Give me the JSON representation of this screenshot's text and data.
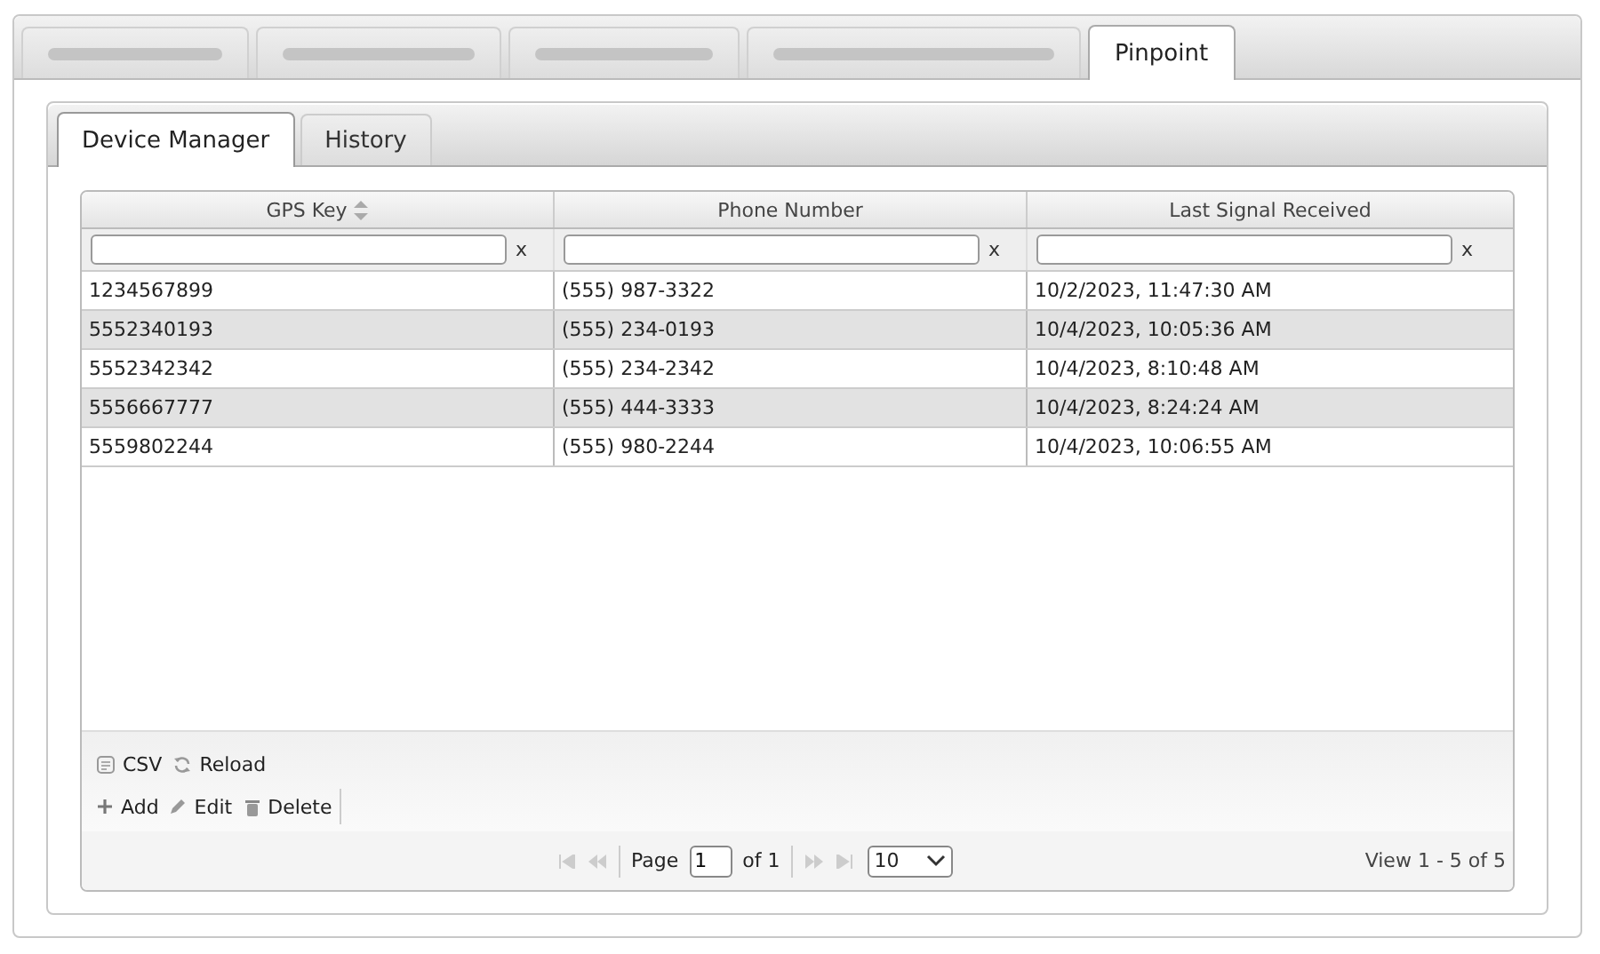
{
  "top_tabs": [
    {
      "kind": "redacted",
      "selected": false
    },
    {
      "kind": "redacted",
      "selected": false
    },
    {
      "kind": "redacted",
      "selected": false
    },
    {
      "kind": "redacted",
      "selected": false
    },
    {
      "kind": "text",
      "label": "Pinpoint",
      "selected": true
    }
  ],
  "sub_tabs": [
    {
      "label": "Device Manager",
      "selected": true
    },
    {
      "label": "History",
      "selected": false
    }
  ],
  "table": {
    "columns": [
      {
        "label": "GPS Key",
        "sortable": true
      },
      {
        "label": "Phone Number",
        "sortable": false
      },
      {
        "label": "Last Signal Received",
        "sortable": false
      }
    ],
    "filter_clear": [
      "x",
      "x",
      "x"
    ],
    "rows": [
      [
        "1234567899",
        "(555) 987-3322",
        "10/2/2023, 11:47:30 AM"
      ],
      [
        "5552340193",
        "(555) 234-0193",
        "10/4/2023, 10:05:36 AM"
      ],
      [
        "5552342342",
        "(555) 234-2342",
        "10/4/2023, 8:10:48 AM"
      ],
      [
        "5556667777",
        "(555) 444-3333",
        "10/4/2023, 8:24:24 AM"
      ],
      [
        "5559802244",
        "(555) 980-2244",
        "10/4/2023, 10:06:55 AM"
      ]
    ]
  },
  "toolbar_rows": [
    [
      {
        "label": "CSV",
        "kind": "csv"
      },
      {
        "label": "Reload",
        "kind": "reload"
      }
    ],
    [
      {
        "label": "Add",
        "kind": "add"
      },
      {
        "label": "Edit",
        "kind": "edit"
      },
      {
        "label": "Delete",
        "kind": "delete"
      }
    ]
  ],
  "pager": {
    "page_label": "Page",
    "page": "1",
    "of_label": "of 1",
    "page_size": "10",
    "summary": "View 1 - 5 of 5"
  }
}
